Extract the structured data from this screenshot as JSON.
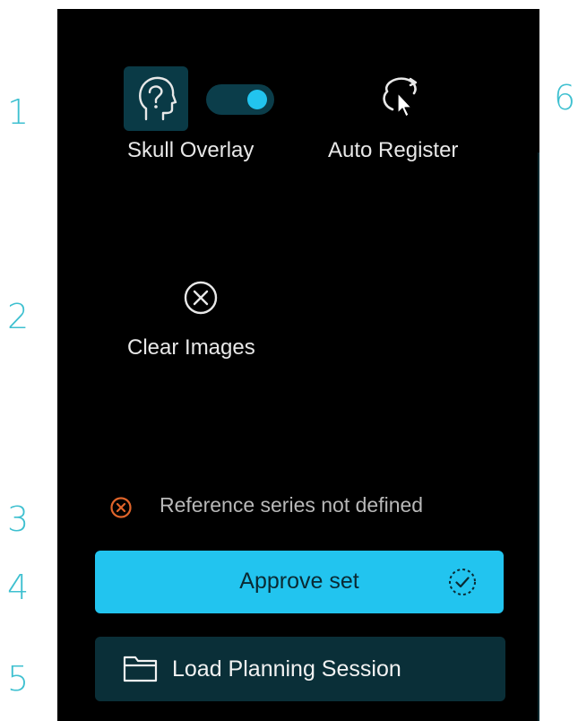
{
  "callouts": [
    "1",
    "2",
    "3",
    "4",
    "5",
    "6"
  ],
  "toolbar": {
    "skull_overlay": {
      "label": "Skull Overlay",
      "icon": "head-profile-icon",
      "toggle_on": true
    },
    "auto_register": {
      "label": "Auto Register",
      "icon": "rotate-cursor-icon"
    },
    "clear_images": {
      "label": "Clear Images",
      "icon": "close-circle-icon"
    }
  },
  "status": {
    "text": "Reference series not defined",
    "icon": "error-circle-icon",
    "color": "#e0642a"
  },
  "actions": {
    "approve": {
      "label": "Approve set",
      "icon": "check-circle-icon"
    },
    "load": {
      "label": "Load Planning Session",
      "icon": "folder-icon"
    }
  },
  "colors": {
    "accent": "#22c4ef",
    "panel": "#000000",
    "button_dark": "#0a2f38",
    "callout": "#3ec0d0"
  }
}
